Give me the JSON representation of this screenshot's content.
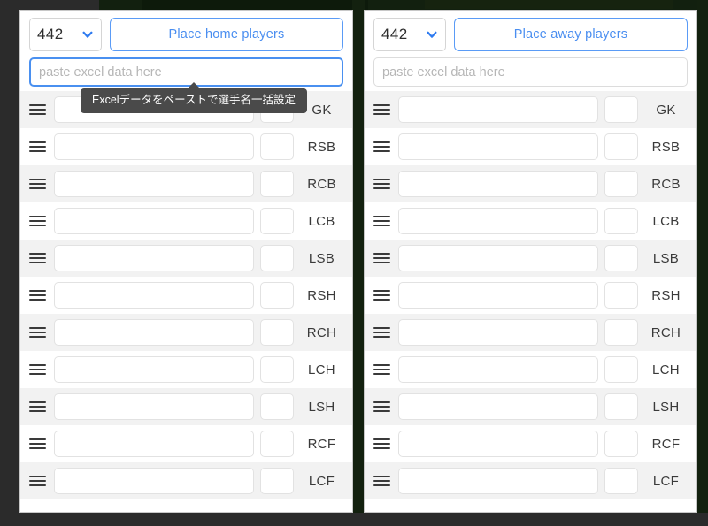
{
  "theme": {
    "accent_blue": "#4a8ef0",
    "focus_blue": "#4a90f0",
    "stripe_gray": "#f2f2f2",
    "backdrop_dark": "#2b2b2b",
    "backdrop_green": "#12200f",
    "tooltip_bg": "#4a4a4a"
  },
  "panels": [
    {
      "id": "home",
      "formation": {
        "value": "442",
        "chevron_icon": "chevron-down-icon"
      },
      "place_button_label": "Place home players",
      "paste_input": {
        "value": "",
        "placeholder": "paste excel data here",
        "focused": true
      },
      "tooltip": {
        "visible": true,
        "text": "Excelデータをペーストで選手名一括設定"
      },
      "rows": [
        {
          "handle_icon": "drag-handle-icon",
          "name": "",
          "number": "",
          "position": "GK"
        },
        {
          "handle_icon": "drag-handle-icon",
          "name": "",
          "number": "",
          "position": "RSB"
        },
        {
          "handle_icon": "drag-handle-icon",
          "name": "",
          "number": "",
          "position": "RCB"
        },
        {
          "handle_icon": "drag-handle-icon",
          "name": "",
          "number": "",
          "position": "LCB"
        },
        {
          "handle_icon": "drag-handle-icon",
          "name": "",
          "number": "",
          "position": "LSB"
        },
        {
          "handle_icon": "drag-handle-icon",
          "name": "",
          "number": "",
          "position": "RSH"
        },
        {
          "handle_icon": "drag-handle-icon",
          "name": "",
          "number": "",
          "position": "RCH"
        },
        {
          "handle_icon": "drag-handle-icon",
          "name": "",
          "number": "",
          "position": "LCH"
        },
        {
          "handle_icon": "drag-handle-icon",
          "name": "",
          "number": "",
          "position": "LSH"
        },
        {
          "handle_icon": "drag-handle-icon",
          "name": "",
          "number": "",
          "position": "RCF"
        },
        {
          "handle_icon": "drag-handle-icon",
          "name": "",
          "number": "",
          "position": "LCF"
        }
      ]
    },
    {
      "id": "away",
      "formation": {
        "value": "442",
        "chevron_icon": "chevron-down-icon"
      },
      "place_button_label": "Place away players",
      "paste_input": {
        "value": "",
        "placeholder": "paste excel data here",
        "focused": false
      },
      "tooltip": {
        "visible": false,
        "text": ""
      },
      "rows": [
        {
          "handle_icon": "drag-handle-icon",
          "name": "",
          "number": "",
          "position": "GK"
        },
        {
          "handle_icon": "drag-handle-icon",
          "name": "",
          "number": "",
          "position": "RSB"
        },
        {
          "handle_icon": "drag-handle-icon",
          "name": "",
          "number": "",
          "position": "RCB"
        },
        {
          "handle_icon": "drag-handle-icon",
          "name": "",
          "number": "",
          "position": "LCB"
        },
        {
          "handle_icon": "drag-handle-icon",
          "name": "",
          "number": "",
          "position": "LSB"
        },
        {
          "handle_icon": "drag-handle-icon",
          "name": "",
          "number": "",
          "position": "RSH"
        },
        {
          "handle_icon": "drag-handle-icon",
          "name": "",
          "number": "",
          "position": "RCH"
        },
        {
          "handle_icon": "drag-handle-icon",
          "name": "",
          "number": "",
          "position": "LCH"
        },
        {
          "handle_icon": "drag-handle-icon",
          "name": "",
          "number": "",
          "position": "LSH"
        },
        {
          "handle_icon": "drag-handle-icon",
          "name": "",
          "number": "",
          "position": "RCF"
        },
        {
          "handle_icon": "drag-handle-icon",
          "name": "",
          "number": "",
          "position": "LCF"
        }
      ]
    }
  ]
}
